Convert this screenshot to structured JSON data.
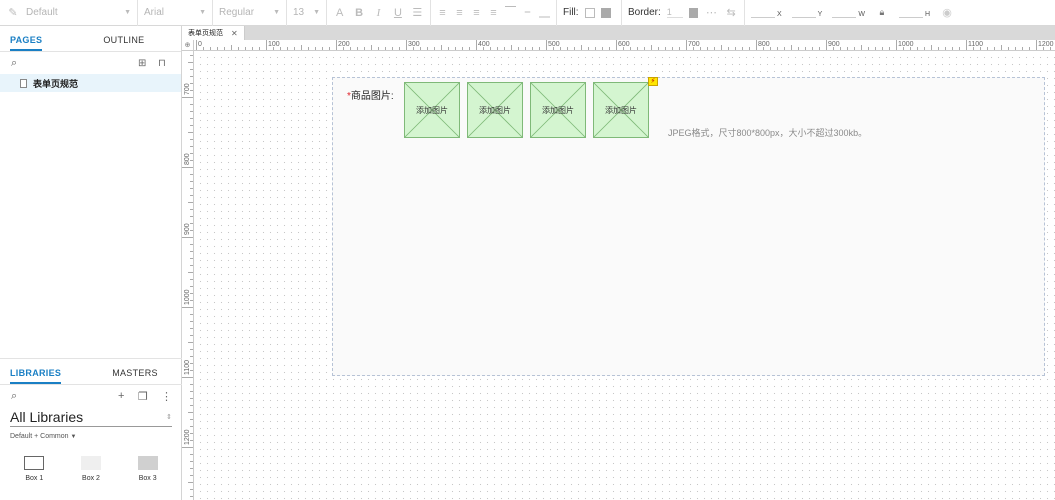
{
  "toolbar": {
    "style_select": "Default",
    "font_select": "Arial",
    "weight_select": "Regular",
    "size_select": "13",
    "fill_label": "Fill:",
    "border_label": "Border:",
    "border_width": "1",
    "x_label": "X",
    "y_label": "Y",
    "w_label": "W",
    "h_label": "H"
  },
  "left_panel": {
    "tabs": [
      {
        "label": "PAGES"
      },
      {
        "label": "OUTLINE"
      }
    ],
    "pages": [
      {
        "label": "表单页规范"
      }
    ],
    "library_tabs": [
      {
        "label": "LIBRARIES"
      },
      {
        "label": "MASTERS"
      }
    ],
    "library_title": "All Libraries",
    "library_subtitle": "Default + Common",
    "widgets": [
      {
        "label": "Box 1"
      },
      {
        "label": "Box 2"
      },
      {
        "label": "Box 3"
      }
    ]
  },
  "document_tab": {
    "title": "表单页规范"
  },
  "rulers": {
    "horizontal": [
      "0",
      "100",
      "200",
      "300",
      "400",
      "500",
      "600",
      "700",
      "800",
      "900",
      "1000",
      "1100",
      "1200"
    ],
    "vertical": [
      "700",
      "800",
      "900",
      "1000",
      "1100",
      "1200",
      "1300"
    ]
  },
  "canvas": {
    "required_mark": "*",
    "field_label": "商品图片:",
    "image_placeholders": [
      {
        "label": "添加图片"
      },
      {
        "label": "添加图片"
      },
      {
        "label": "添加图片"
      },
      {
        "label": "添加图片"
      }
    ],
    "hint_text": "JPEG格式，尺寸800*800px，大小不超过300kb。"
  }
}
